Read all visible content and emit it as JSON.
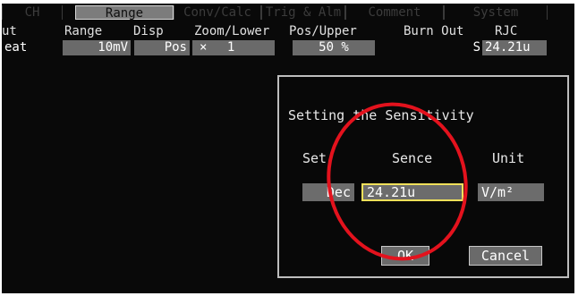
{
  "tabs": [
    "CH",
    "Range",
    "Conv/Calc",
    "Trig & Alm",
    "Comment",
    "System"
  ],
  "columns": [
    "ut",
    "Range",
    "Disp",
    "Zoom/Lower",
    "Pos/Upper",
    "Burn Out",
    "RJC"
  ],
  "row": {
    "mode": "eat",
    "range": "10mV",
    "disp": "Pos",
    "zoom_symbol": "×",
    "zoom": "1",
    "pos": "50 %",
    "burnout": "S",
    "rjc": "24.21u"
  },
  "dialog": {
    "title": "Setting the Sensitivity",
    "set_label": "Set",
    "sence_label": "Sence",
    "unit_label": "Unit",
    "set_value": "Dec",
    "sence_value": "24.21u",
    "unit_value": "V/m²",
    "ok_label": "OK",
    "cancel_label": "Cancel"
  },
  "colors": {
    "background": "#090909",
    "active_tab": "#7c7c7c",
    "field": "#6a6a6a",
    "selection": "#f0e05a",
    "annotation": "#e3121d"
  }
}
